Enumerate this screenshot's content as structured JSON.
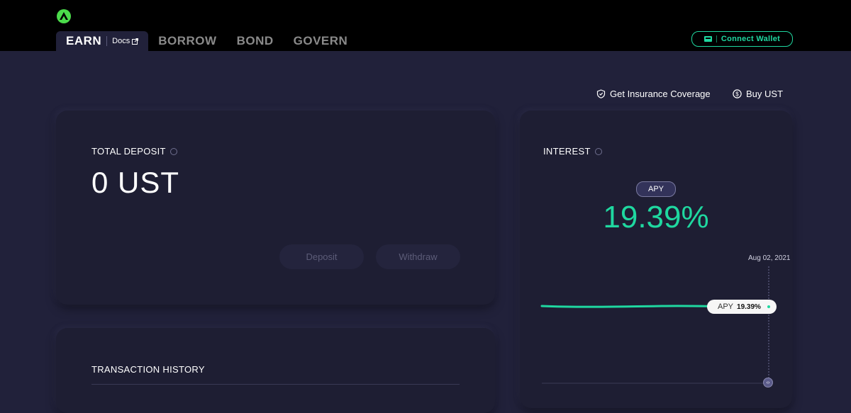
{
  "header": {
    "nav": {
      "active": "EARN",
      "docs": "Docs",
      "items": [
        "BORROW",
        "BOND",
        "GOVERN"
      ]
    },
    "connect_wallet": "Connect Wallet"
  },
  "actions": {
    "insurance": "Get Insurance Coverage",
    "buy": "Buy UST"
  },
  "deposit": {
    "title": "TOTAL DEPOSIT",
    "amount": "0 UST",
    "deposit_button": "Deposit",
    "withdraw_button": "Withdraw"
  },
  "interest": {
    "title": "INTEREST",
    "badge": "APY",
    "value": "19.39%",
    "chart_date": "Aug 02, 2021",
    "tooltip_label": "APY",
    "tooltip_value": "19.39%"
  },
  "history": {
    "title": "TRANSACTION HISTORY"
  },
  "colors": {
    "accent": "#1fd8a0",
    "background": "#21213a",
    "card": "#1e1e33",
    "topbar": "#000000",
    "logo": "#4bdb4b"
  },
  "icons": {
    "logo": "anchor-logo-icon",
    "docs": "external-link-icon",
    "wallet": "wallet-icon",
    "insurance": "shield-icon",
    "buy": "dollar-circle-icon",
    "info": "info-icon",
    "slider": "drag-handle-icon"
  }
}
